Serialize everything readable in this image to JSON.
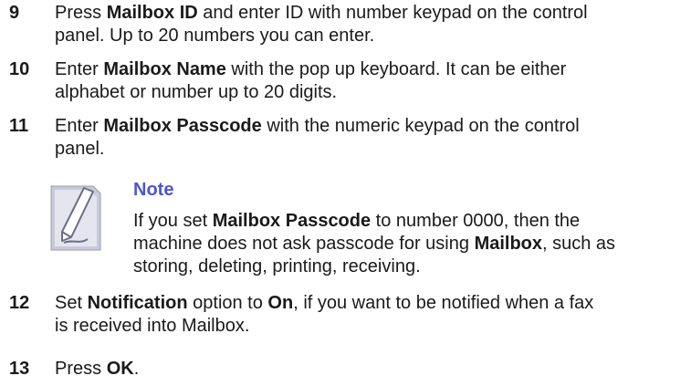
{
  "steps": [
    {
      "number": "9",
      "line1_a": "Press ",
      "line1_b": "Mailbox ID",
      "line1_c": " and enter ID with number keypad on the control",
      "line2": "panel. Up to 20 numbers you can enter."
    },
    {
      "number": "10",
      "line1_a": "Enter ",
      "line1_b": "Mailbox Name",
      "line1_c": " with the pop up keyboard. It can be either",
      "line2": "alphabet or number up to 20 digits."
    },
    {
      "number": "11",
      "line1_a": "Enter ",
      "line1_b": "Mailbox Passcode",
      "line1_c": " with the numeric keypad on the control",
      "line2": "panel."
    },
    {
      "number": "12",
      "line1_a": "Set ",
      "line1_b": "Notification",
      "line1_c": " option to ",
      "line1_d": "On",
      "line1_e": ", if you want to be notified when a fax",
      "line2": "is received into Mailbox."
    },
    {
      "number": "13",
      "line1_a": "Press ",
      "line1_b": "OK",
      "line1_c": "."
    }
  ],
  "note": {
    "title": "Note",
    "line1_a": "If you set ",
    "line1_b": "Mailbox Passcode",
    "line1_c": " to number 0000, then the",
    "line2_a": "machine does not ask passcode for using ",
    "line2_b": "Mailbox",
    "line2_c": ", such as",
    "line3": "storing, deleting, printing, receiving."
  }
}
